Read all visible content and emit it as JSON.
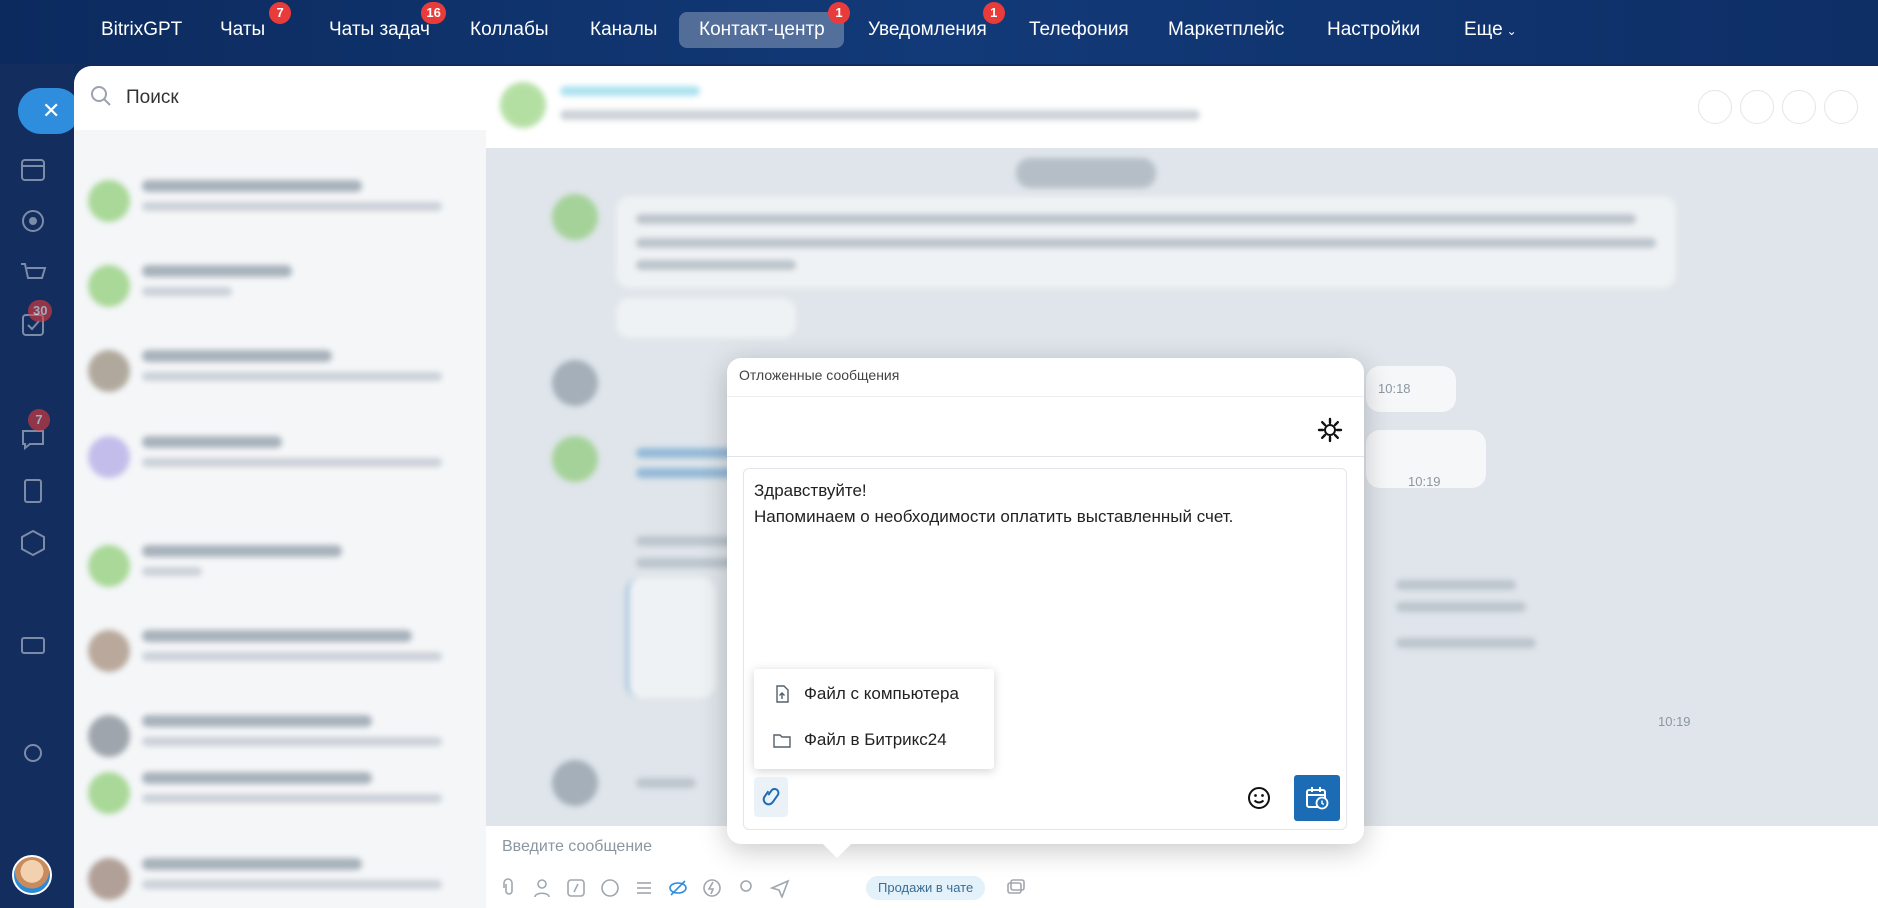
{
  "topnav": {
    "items": [
      {
        "label": "BitrixGPT",
        "badge": ""
      },
      {
        "label": "Чаты",
        "badge": "7"
      },
      {
        "label": "Чаты задач",
        "badge": "16"
      },
      {
        "label": "Коллабы",
        "badge": ""
      },
      {
        "label": "Каналы",
        "badge": ""
      },
      {
        "label": "Контакт-центр",
        "badge": "1",
        "active": true
      },
      {
        "label": "Уведомления",
        "badge": "1"
      },
      {
        "label": "Телефония",
        "badge": ""
      },
      {
        "label": "Маркетплейс",
        "badge": ""
      },
      {
        "label": "Настройки",
        "badge": ""
      },
      {
        "label": "Еще",
        "badge": ""
      }
    ]
  },
  "leftnav": {
    "badges": [
      "30",
      "7"
    ]
  },
  "chatlist": {
    "search_placeholder": "Поиск"
  },
  "chat": {
    "times": [
      "10:18",
      "10:19",
      "10:19"
    ],
    "composer_placeholder": "Введите сообщение",
    "sales_label": "Продажи в чате"
  },
  "popup": {
    "title": "Отложенные сообщения",
    "message_lines": [
      "Здравствуйте!",
      "Напоминаем о необходимости оплатить выставленный счет."
    ],
    "file_menu": [
      "Файл с компьютера",
      "Файл в Битрикс24"
    ]
  },
  "colors": {
    "accent": "#1b6cb5",
    "badge": "#ea3b3b",
    "nav_bg": "#0c2a5e"
  }
}
